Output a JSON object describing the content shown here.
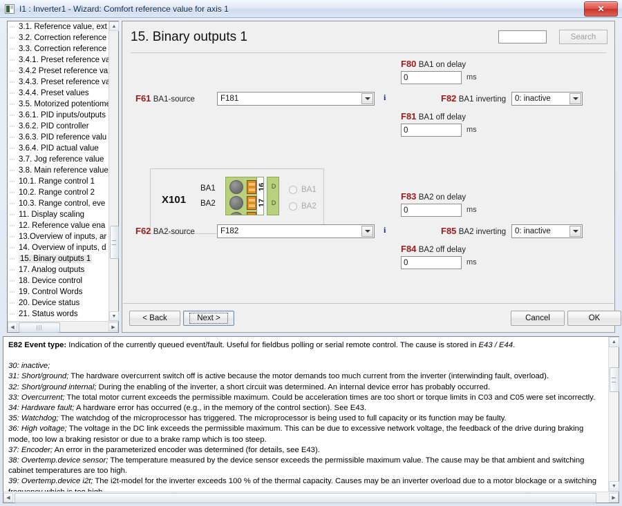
{
  "window": {
    "title": "I1 : Inverter1 - Wizard: Comfort reference value for axis 1",
    "close_label": "✕"
  },
  "tree": {
    "items": [
      {
        "label": "3.1. Reference value, ext"
      },
      {
        "label": "3.2. Correction reference"
      },
      {
        "label": "3.3. Correction reference"
      },
      {
        "label": "3.4.1. Preset reference va"
      },
      {
        "label": "3.4.2 Preset reference va"
      },
      {
        "label": "3.4.3. Preset reference va"
      },
      {
        "label": "3.4.4. Preset values"
      },
      {
        "label": "3.5. Motorized potentiome"
      },
      {
        "label": "3.6.1. PID inputs/outputs"
      },
      {
        "label": "3.6.2. PID controller"
      },
      {
        "label": "3.6.3. PID reference valu"
      },
      {
        "label": "3.6.4. PID actual value"
      },
      {
        "label": "3.7. Jog reference value"
      },
      {
        "label": "3.8. Main reference value"
      },
      {
        "label": "10.1. Range control 1"
      },
      {
        "label": "10.2. Range control 2"
      },
      {
        "label": "10.3. Range control, eve"
      },
      {
        "label": "11. Display scaling"
      },
      {
        "label": "12. Reference value ena"
      },
      {
        "label": "13.Overview of inputs, ar"
      },
      {
        "label": "14. Overview of inputs, d"
      },
      {
        "label": "15. Binary outputs 1",
        "selected": true
      },
      {
        "label": "17. Analog outputs"
      },
      {
        "label": "18. Device control"
      },
      {
        "label": "19. Control Words"
      },
      {
        "label": "20. Device status"
      },
      {
        "label": "21. Status words"
      }
    ]
  },
  "panel": {
    "title": "15. Binary outputs 1",
    "search": {
      "value": "",
      "placeholder": "",
      "button_label": "Search"
    },
    "fields": {
      "f61": {
        "code": "F61",
        "label": "BA1-source",
        "value": "F181",
        "info": "i"
      },
      "f62": {
        "code": "F62",
        "label": "BA2-source",
        "value": "F182",
        "info": "i"
      },
      "f80": {
        "code": "F80",
        "label": "BA1 on delay",
        "value": "0",
        "unit": "ms"
      },
      "f81": {
        "code": "F81",
        "label": "BA1 off delay",
        "value": "0",
        "unit": "ms"
      },
      "f82": {
        "code": "F82",
        "label": "BA1 inverting",
        "value": "0: inactive"
      },
      "f83": {
        "code": "F83",
        "label": "BA2 on delay",
        "value": "0",
        "unit": "ms"
      },
      "f84": {
        "code": "F84",
        "label": "BA2 off delay",
        "value": "0",
        "unit": "ms"
      },
      "f85": {
        "code": "F85",
        "label": "BA2 inverting",
        "value": "0: inactive"
      }
    },
    "terminal": {
      "name": "X101",
      "pin1_label": "BA1",
      "pin2_label": "BA2",
      "terminal_number_1": "16",
      "terminal_number_2": "17",
      "d_marker_1": "D",
      "d_marker_2": "D",
      "radio1_label": "BA1",
      "radio2_label": "BA2"
    }
  },
  "footer": {
    "back_label": "< Back",
    "next_label": "Next >",
    "cancel_label": "Cancel",
    "ok_label": "OK"
  },
  "help": {
    "header_code": "E82",
    "header_title": "Event type:",
    "header_text": " Indication of the currently queued event/fault. Useful for fieldbus polling or serial remote control. The cause is stored in ",
    "header_ref1": "E43 / E44",
    "header_end": ".",
    "entries": [
      {
        "num": "30:",
        "term": "inactive;",
        "text": ""
      },
      {
        "num": "31:",
        "term": "Short/ground;",
        "text": " The hardware overcurrent switch off is active because the motor demands too much current from the inverter (interwinding fault, overload)."
      },
      {
        "num": "32:",
        "term": "Short/ground internal;",
        "text": " During the enabling of the inverter, a short circuit was determined. An internal device error has probably occurred."
      },
      {
        "num": "33:",
        "term": "Overcurrent;",
        "text": " The total motor current exceeds the permissible maximum. Could be acceleration times are too short or torque limits in C03 and C05 were set incorrectly."
      },
      {
        "num": "34:",
        "term": "Hardware fault;",
        "text": " A hardware error has occurred (e.g., in the memory of the control section). See E43."
      },
      {
        "num": "35:",
        "term": "Watchdog;",
        "text": " The watchdog of the microprocessor has triggered. The microprocessor is being used to full capacity or its function may be faulty."
      },
      {
        "num": "36:",
        "term": "High voltage;",
        "text": " The voltage in the DC link exceeds the permissible maximum. This can be due to excessive network voltage, the feedback of the drive during braking mode, too low a braking resistor or due to a brake ramp which is too steep."
      },
      {
        "num": "37:",
        "term": "Encoder;",
        "text": " An error in the parameterized encoder was determined (for details, see E43)."
      },
      {
        "num": "38:",
        "term": "Overtemp.device sensor;",
        "text": " The temperature measured by the device sensor exceeds the permissible maximum value. The cause may be that ambient and switching cabinet temperatures are too high."
      },
      {
        "num": "39:",
        "term": "Overtemp.device i2t;",
        "text": " The i2t-model for the inverter exceeds 100 % of the thermal capacity. Causes may be an inverter overload due to a motor blockage or a switching frequency which is too high."
      }
    ]
  },
  "colors": {
    "param_code": "#9c1b1b",
    "title_text": "#0b2a4a",
    "connector_green": "#b9d17f",
    "contact_orange": "#e08c1e",
    "info_blue": "#2222aa"
  }
}
